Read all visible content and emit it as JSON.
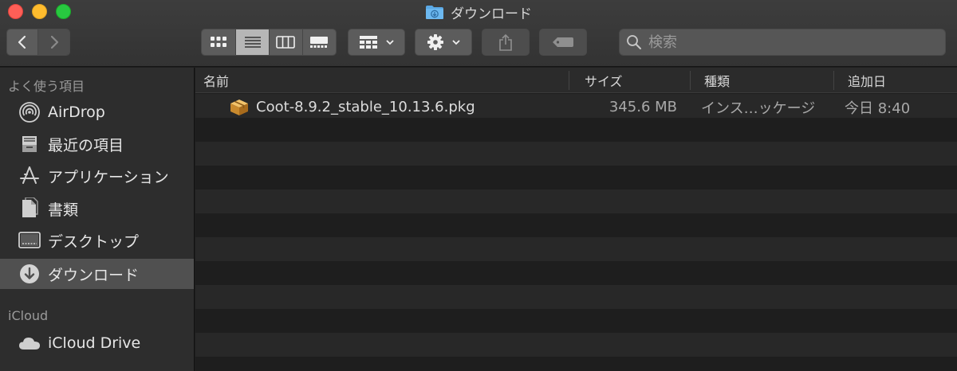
{
  "window": {
    "title": "ダウンロード",
    "colors": {
      "close": "#fe5f57",
      "minimize": "#febc2e",
      "maximize": "#28c840"
    }
  },
  "toolbar": {
    "back_icon": "chevron-left-icon",
    "forward_icon": "chevron-right-icon",
    "view_modes": [
      "icon-view-icon",
      "list-view-icon",
      "column-view-icon",
      "gallery-view-icon"
    ],
    "active_view": "list-view-icon",
    "group_icon": "group-by-icon",
    "action_icon": "gear-icon",
    "share_icon": "share-icon",
    "tag_icon": "tag-icon",
    "search": {
      "placeholder": "検索",
      "value": ""
    }
  },
  "sidebar": {
    "favorites_label": "よく使う項目",
    "items": [
      {
        "label": "AirDrop",
        "icon": "airdrop-icon"
      },
      {
        "label": "最近の項目",
        "icon": "recents-icon"
      },
      {
        "label": "アプリケーション",
        "icon": "applications-icon"
      },
      {
        "label": "書類",
        "icon": "documents-icon"
      },
      {
        "label": "デスクトップ",
        "icon": "desktop-icon"
      },
      {
        "label": "ダウンロード",
        "icon": "downloads-icon",
        "selected": true
      }
    ],
    "icloud_label": "iCloud",
    "icloud_items": [
      {
        "label": "iCloud Drive",
        "icon": "cloud-icon"
      }
    ]
  },
  "list": {
    "columns": [
      "名前",
      "サイズ",
      "種類",
      "追加日"
    ],
    "rows": [
      {
        "name": "Coot-8.9.2_stable_10.13.6.pkg",
        "size": "345.6 MB",
        "kind": "インス…ッケージ",
        "added": "今日 8:40",
        "icon": "package-icon"
      }
    ]
  }
}
